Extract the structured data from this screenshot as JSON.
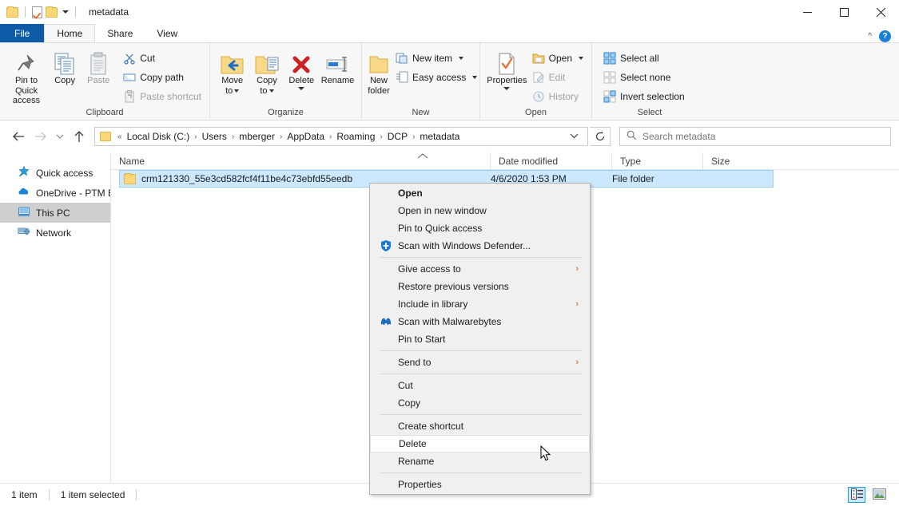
{
  "window": {
    "title": "metadata",
    "quick_access_icons": [
      "folder-icon",
      "properties-icon",
      "folder-icon"
    ],
    "controls": {
      "minimize": "minimize-icon",
      "maximize": "maximize-icon",
      "close": "close-icon"
    }
  },
  "ribbon": {
    "tabs": [
      {
        "label": "File",
        "active": false,
        "style": "file"
      },
      {
        "label": "Home",
        "active": true
      },
      {
        "label": "Share",
        "active": false
      },
      {
        "label": "View",
        "active": false
      }
    ],
    "collapse_icon": "chevron-up-icon",
    "help_icon": "help-icon",
    "groups": [
      {
        "title": "Clipboard",
        "big_buttons": [
          {
            "label_line1": "Pin to Quick",
            "label_line2": "access",
            "icon": "pin-icon",
            "disabled": false
          },
          {
            "label_line1": "Copy",
            "label_line2": "",
            "icon": "copy-icon",
            "disabled": false
          },
          {
            "label_line1": "Paste",
            "label_line2": "",
            "icon": "paste-icon",
            "disabled": true
          }
        ],
        "small_buttons": [
          {
            "label": "Cut",
            "icon": "scissors-icon",
            "disabled": false
          },
          {
            "label": "Copy path",
            "icon": "copy-path-icon",
            "disabled": false
          },
          {
            "label": "Paste shortcut",
            "icon": "paste-shortcut-icon",
            "disabled": true
          }
        ]
      },
      {
        "title": "Organize",
        "big_buttons": [
          {
            "label_line1": "Move",
            "label_line2": "to",
            "icon": "move-to-icon",
            "dropdown": true
          },
          {
            "label_line1": "Copy",
            "label_line2": "to",
            "icon": "copy-to-icon",
            "dropdown": true
          },
          {
            "label_line1": "Delete",
            "label_line2": "",
            "icon": "delete-x-icon",
            "dropdown": true
          },
          {
            "label_line1": "Rename",
            "label_line2": "",
            "icon": "rename-icon",
            "dropdown": false
          }
        ]
      },
      {
        "title": "New",
        "big_buttons": [
          {
            "label_line1": "New",
            "label_line2": "folder",
            "icon": "new-folder-icon"
          }
        ],
        "small_buttons": [
          {
            "label": "New item",
            "icon": "new-item-icon",
            "dropdown": true
          },
          {
            "label": "Easy access",
            "icon": "easy-access-icon",
            "dropdown": true
          }
        ]
      },
      {
        "title": "Open",
        "big_buttons": [
          {
            "label_line1": "Properties",
            "label_line2": "",
            "icon": "properties-icon",
            "dropdown": true
          }
        ],
        "small_buttons": [
          {
            "label": "Open",
            "icon": "open-folder-icon",
            "dropdown": true,
            "disabled": false
          },
          {
            "label": "Edit",
            "icon": "edit-icon",
            "disabled": true
          },
          {
            "label": "History",
            "icon": "history-icon",
            "disabled": true
          }
        ]
      },
      {
        "title": "Select",
        "small_buttons": [
          {
            "label": "Select all",
            "icon": "select-all-icon"
          },
          {
            "label": "Select none",
            "icon": "select-none-icon"
          },
          {
            "label": "Invert selection",
            "icon": "invert-selection-icon"
          }
        ]
      }
    ]
  },
  "address": {
    "back_icon": "arrow-left-icon",
    "forward_icon": "arrow-right-icon",
    "recent_icon": "chevron-down-icon",
    "up_icon": "arrow-up-icon",
    "prefix": "«",
    "crumbs": [
      "Local Disk (C:)",
      "Users",
      "mberger",
      "AppData",
      "Roaming",
      "DCP",
      "metadata"
    ],
    "dropdown_icon": "chevron-down-icon",
    "refresh_icon": "refresh-icon",
    "search_icon": "search-icon",
    "search_placeholder": "Search metadata",
    "search_value": ""
  },
  "nav_pane": {
    "items": [
      {
        "label": "Quick access",
        "icon": "star-pin-icon",
        "selected": false
      },
      {
        "label": "OneDrive - PTM E",
        "icon": "onedrive-cloud-icon",
        "selected": false
      },
      {
        "label": "This PC",
        "icon": "computer-icon",
        "selected": true
      },
      {
        "label": "Network",
        "icon": "network-icon",
        "selected": false
      }
    ]
  },
  "file_list": {
    "columns": [
      "Name",
      "Date modified",
      "Type",
      "Size"
    ],
    "sort_indicator": "sort-ascending-icon",
    "rows": [
      {
        "name": "crm121330_55e3cd582fcf4f11be4c73ebfd55eedb",
        "date_modified": "4/6/2020 1:53 PM",
        "type": "File folder",
        "size": "",
        "icon": "folder-icon",
        "selected": true
      }
    ]
  },
  "context_menu": {
    "items": [
      {
        "label": "Open",
        "bold": true,
        "icon": null,
        "submenu": false
      },
      {
        "label": "Open in new window",
        "icon": null,
        "submenu": false
      },
      {
        "label": "Pin to Quick access",
        "icon": null,
        "submenu": false
      },
      {
        "label": "Scan with Windows Defender...",
        "icon": "windows-defender-shield-icon",
        "submenu": false
      },
      {
        "separator": true
      },
      {
        "label": "Give access to",
        "icon": null,
        "submenu": true
      },
      {
        "label": "Restore previous versions",
        "icon": null,
        "submenu": false
      },
      {
        "label": "Include in library",
        "icon": null,
        "submenu": true
      },
      {
        "label": "Scan with Malwarebytes",
        "icon": "malwarebytes-icon",
        "submenu": false
      },
      {
        "label": "Pin to Start",
        "icon": null,
        "submenu": false
      },
      {
        "separator": true
      },
      {
        "label": "Send to",
        "icon": null,
        "submenu": true
      },
      {
        "separator": true
      },
      {
        "label": "Cut",
        "icon": null,
        "submenu": false
      },
      {
        "label": "Copy",
        "icon": null,
        "submenu": false
      },
      {
        "separator": true
      },
      {
        "label": "Create shortcut",
        "icon": null,
        "submenu": false
      },
      {
        "label": "Delete",
        "icon": null,
        "submenu": false,
        "highlighted": true
      },
      {
        "label": "Rename",
        "icon": null,
        "submenu": false
      },
      {
        "separator": true
      },
      {
        "label": "Properties",
        "icon": null,
        "submenu": false
      }
    ]
  },
  "status_bar": {
    "item_count": "1 item",
    "selection": "1 item selected",
    "view_details_icon": "details-view-icon",
    "view_thumbnails_icon": "large-icons-view-icon"
  },
  "colors": {
    "accent": "#0d5ba6",
    "selection": "#cce8ff",
    "ribbon_bg": "#f7f7f7",
    "folder": "#fbd779"
  }
}
